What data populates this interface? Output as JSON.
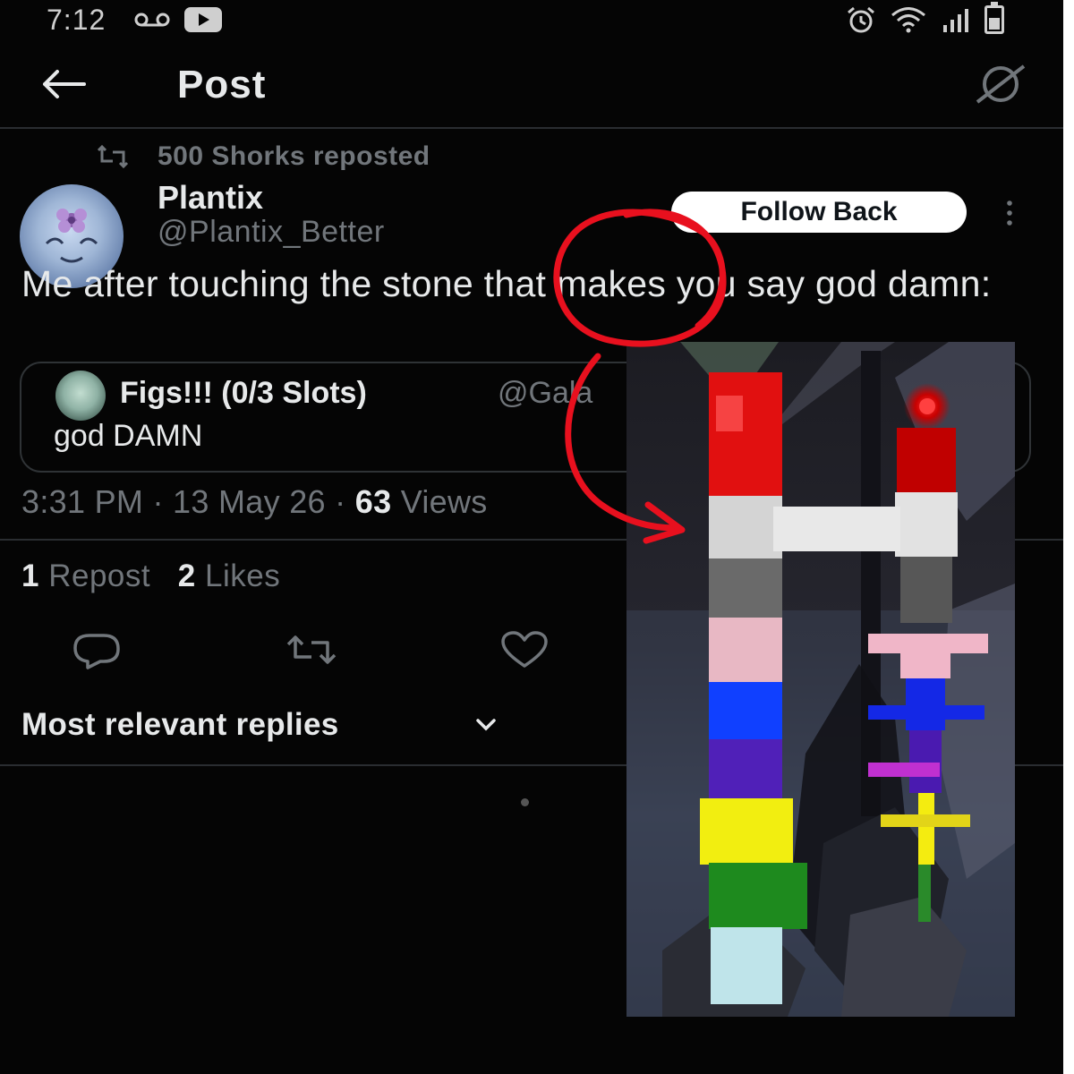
{
  "status_bar": {
    "time": "7:12"
  },
  "header": {
    "title": "Post"
  },
  "repost_notice": "500 Shorks reposted",
  "author": {
    "name": "Plantix",
    "handle": "@Plantix_Better"
  },
  "follow_button": "Follow Back",
  "post_text": "Me after touching the stone that makes you say god damn:",
  "quote": {
    "name": "Figs!!! (0/3 Slots)",
    "handle": "@Gala",
    "text": "god DAMN"
  },
  "meta": {
    "time_date": "3:31 PM · 13 May 26 · ",
    "views_count": "63",
    "views_label": " Views"
  },
  "stats": {
    "reposts": "1",
    "reposts_label": "Repost",
    "likes": "2",
    "likes_label": "Likes"
  },
  "replies_sort": "Most relevant replies",
  "colors": {
    "background": "#050505",
    "text": "#e7e9ea",
    "muted": "#71767b",
    "annotation": "#e8101e"
  },
  "icons": [
    "voicemail-icon",
    "youtube-icon",
    "alarm-icon",
    "wifi-icon",
    "signal-icon",
    "battery-icon",
    "back-arrow-icon",
    "grok-icon",
    "repost-icon",
    "more-options-icon",
    "reply-icon",
    "retweet-icon",
    "like-icon",
    "chevron-down-icon"
  ]
}
